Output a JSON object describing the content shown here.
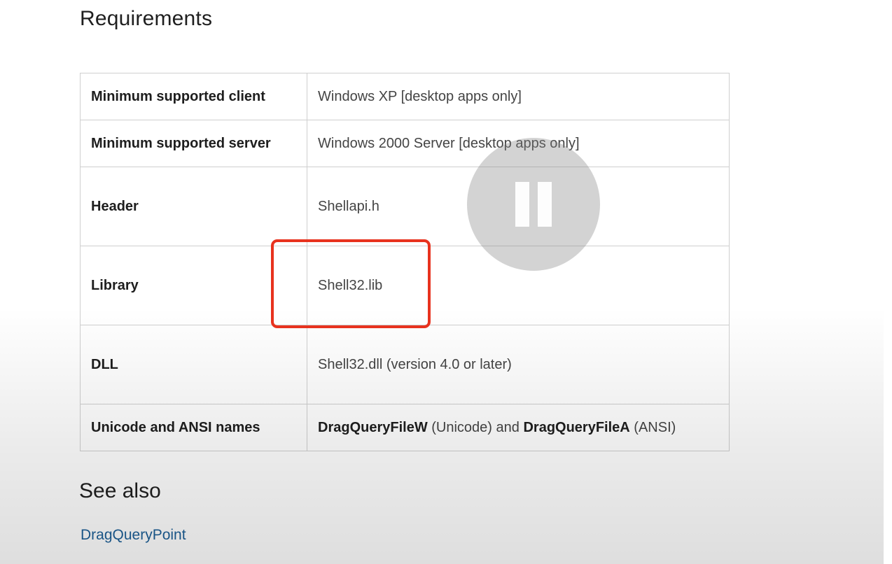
{
  "requirements": {
    "title": "Requirements",
    "rows": [
      {
        "key": "Minimum supported client",
        "value": "Windows XP [desktop apps only]"
      },
      {
        "key": "Minimum supported server",
        "value": "Windows 2000 Server [desktop apps only]"
      },
      {
        "key": "Header",
        "value": "Shellapi.h"
      },
      {
        "key": "Library",
        "value": "Shell32.lib"
      },
      {
        "key": "DLL",
        "value": "Shell32.dll (version 4.0 or later)"
      },
      {
        "key": "Unicode and ANSI names",
        "unicode_name": "DragQueryFileW",
        "unicode_suffix": "(Unicode)",
        "joiner": "and",
        "ansi_name": "DragQueryFileA",
        "ansi_suffix": "(ANSI)"
      }
    ]
  },
  "see_also": {
    "title": "See also",
    "link": "DragQueryPoint"
  },
  "annotation": {
    "highlight_color": "#e8321e"
  },
  "video_overlay": {
    "icon": "pause-icon"
  },
  "colors": {
    "link": "#1c5f97",
    "border": "#cfcfcf"
  }
}
